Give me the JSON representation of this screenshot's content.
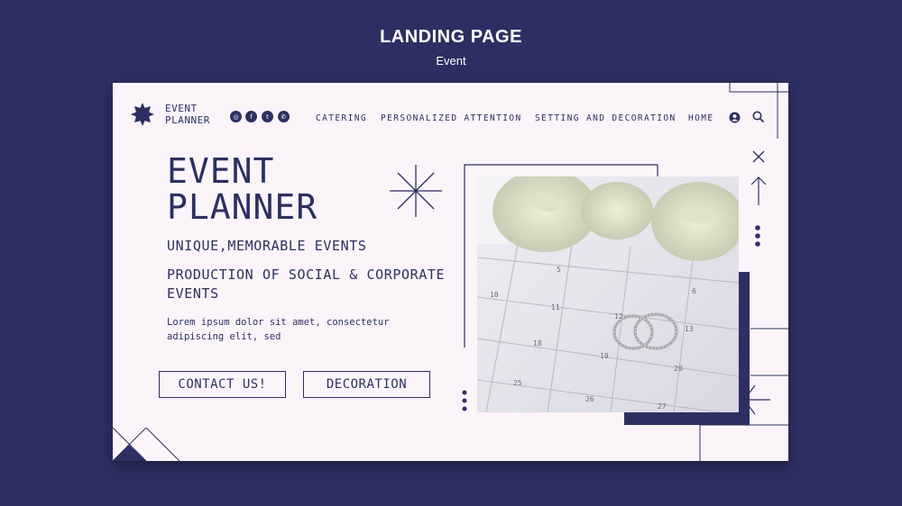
{
  "header": {
    "title": "LANDING PAGE",
    "subtitle": "Event"
  },
  "logo": {
    "line1": "EVENT",
    "line2": "PLANNER"
  },
  "social": [
    {
      "icon": "instagram-icon",
      "glyph": "◎"
    },
    {
      "icon": "facebook-icon",
      "glyph": "f"
    },
    {
      "icon": "twitter-icon",
      "glyph": "t"
    },
    {
      "icon": "whatsapp-icon",
      "glyph": "✆"
    }
  ],
  "nav": {
    "catering": "CATERING",
    "personalized": "PERSONALIZED ATTENTION",
    "setting": "SETTING AND DECORATION",
    "home": "HOME"
  },
  "hero": {
    "title_line1": "EVENT",
    "title_line2": "PLANNER",
    "tagline": "UNIQUE,MEMORABLE EVENTS",
    "production": "PRODUCTION OF SOCIAL & CORPORATE EVENTS",
    "lorem": "Lorem ipsum dolor sit amet, consectetur adipiscing elit, sed"
  },
  "buttons": {
    "contact": "CONTACT US!",
    "decoration": "DECORATION"
  },
  "calendar_numbers": [
    "5",
    "6",
    "10",
    "11",
    "12",
    "13",
    "18",
    "19",
    "20",
    "25",
    "26",
    "27"
  ],
  "colors": {
    "navy": "#2d2f63",
    "card": "#fbf5fa",
    "white": "#ffffff"
  }
}
